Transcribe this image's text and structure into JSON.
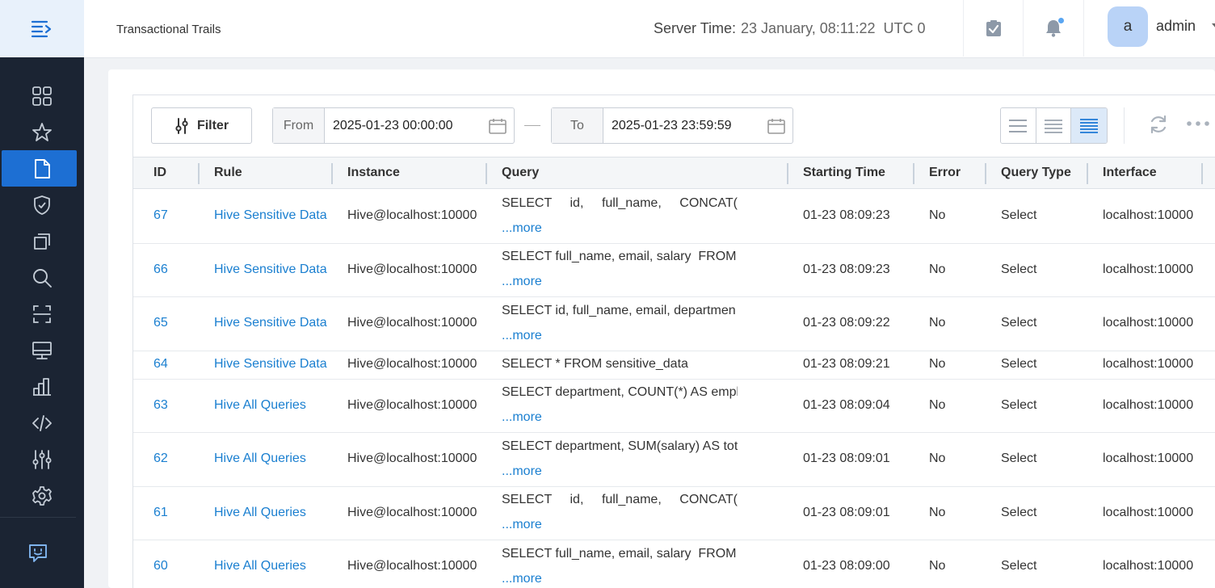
{
  "header": {
    "title": "Transactional Trails",
    "server_time_label": "Server Time:",
    "server_time_value": "23 January, 08:11:22  UTC 0",
    "avatar_letter": "a",
    "username": "admin"
  },
  "toolbar": {
    "filter_label": "Filter",
    "from_label": "From",
    "from_value": "2025-01-23 00:00:00",
    "to_label": "To",
    "to_value": "2025-01-23 23:59:59"
  },
  "table": {
    "columns": [
      "ID",
      "Rule",
      "Instance",
      "Query",
      "Starting Time",
      "Error",
      "Query Type",
      "Interface"
    ],
    "more_label": "...more",
    "rows": [
      {
        "id": "67",
        "rule": "Hive Sensitive Data",
        "instance": "Hive@localhost:10000",
        "query": "SELECT id, full_name, CONCAT(",
        "time": "01-23 08:09:23",
        "error": "No",
        "type": "Select",
        "interface": "localhost:10000"
      },
      {
        "id": "66",
        "rule": "Hive Sensitive Data",
        "instance": "Hive@localhost:10000",
        "query": "SELECT full_name, email, salary  FROM",
        "time": "01-23 08:09:23",
        "error": "No",
        "type": "Select",
        "interface": "localhost:10000"
      },
      {
        "id": "65",
        "rule": "Hive Sensitive Data",
        "instance": "Hive@localhost:10000",
        "query": "SELECT id, full_name, email, departmen",
        "time": "01-23 08:09:22",
        "error": "No",
        "type": "Select",
        "interface": "localhost:10000"
      },
      {
        "id": "64",
        "rule": "Hive Sensitive Data",
        "instance": "Hive@localhost:10000",
        "query": "SELECT * FROM sensitive_data",
        "time": "01-23 08:09:21",
        "error": "No",
        "type": "Select",
        "interface": "localhost:10000"
      },
      {
        "id": "63",
        "rule": "Hive All Queries",
        "instance": "Hive@localhost:10000",
        "query": "SELECT department, COUNT(*) AS empl",
        "time": "01-23 08:09:04",
        "error": "No",
        "type": "Select",
        "interface": "localhost:10000"
      },
      {
        "id": "62",
        "rule": "Hive All Queries",
        "instance": "Hive@localhost:10000",
        "query": "SELECT department, SUM(salary) AS tot",
        "time": "01-23 08:09:01",
        "error": "No",
        "type": "Select",
        "interface": "localhost:10000"
      },
      {
        "id": "61",
        "rule": "Hive All Queries",
        "instance": "Hive@localhost:10000",
        "query": "SELECT id, full_name, CONCAT(",
        "time": "01-23 08:09:01",
        "error": "No",
        "type": "Select",
        "interface": "localhost:10000"
      },
      {
        "id": "60",
        "rule": "Hive All Queries",
        "instance": "Hive@localhost:10000",
        "query": "SELECT full_name, email, salary  FROM",
        "time": "01-23 08:09:00",
        "error": "No",
        "type": "Select",
        "interface": "localhost:10000"
      }
    ]
  },
  "sidebar": {
    "items": [
      "dashboard-icon",
      "star-icon",
      "document-icon",
      "shield-icon",
      "copy-icon",
      "search-icon",
      "scan-icon",
      "monitor-icon",
      "bar-chart-icon",
      "code-icon",
      "sliders-icon",
      "gear-icon"
    ],
    "active_index": 2,
    "bottom": "feedback-icon"
  },
  "colors": {
    "sidebar_bg": "#1b2433",
    "accent": "#1d6fd3",
    "link": "#1a7fd0"
  }
}
